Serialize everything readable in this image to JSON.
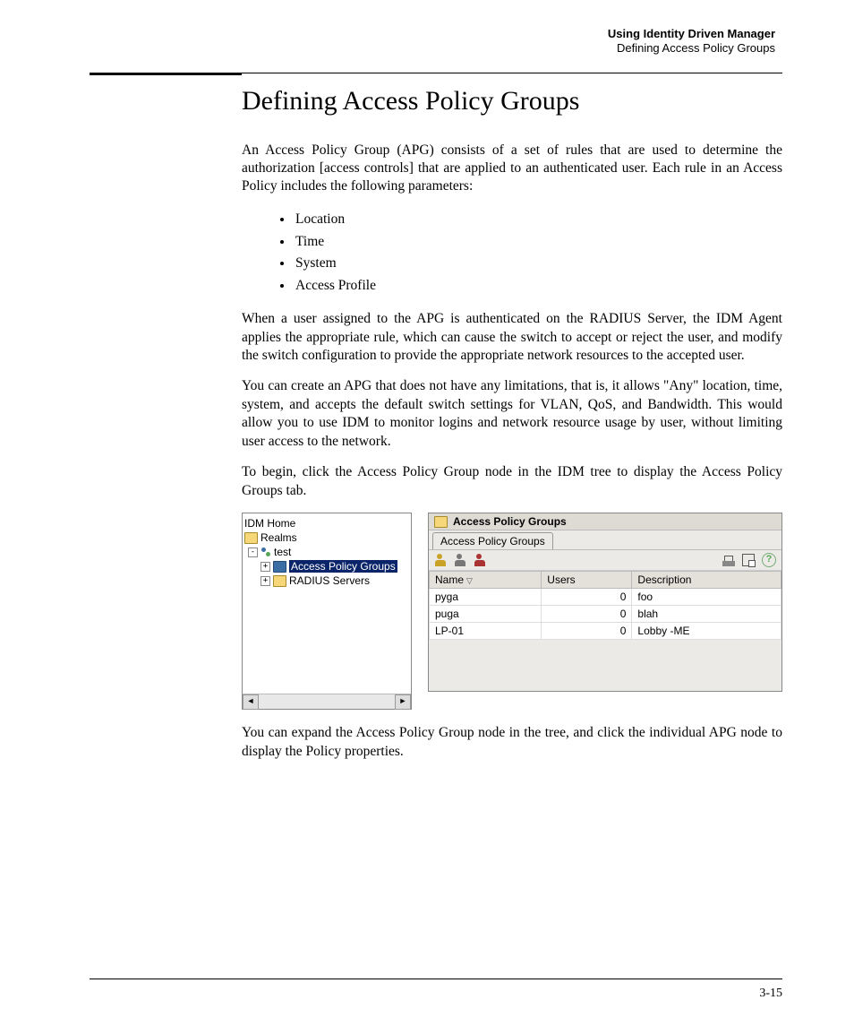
{
  "runningHead": {
    "bold": "Using Identity Driven Manager",
    "light": "Defining Access Policy Groups"
  },
  "title": "Defining Access Policy Groups",
  "para1": "An Access Policy Group (APG) consists of a set of rules that are used to determine the authorization [access controls] that are applied to an authenticated user. Each rule in an Access Policy includes the following parameters:",
  "bullets": [
    "Location",
    "Time",
    "System",
    "Access Profile"
  ],
  "para2": "When a user assigned to the APG is authenticated on the RADIUS Server, the IDM Agent applies the appropriate rule, which can cause the switch to accept or reject the user, and modify the switch configuration to provide the appropriate network resources to the accepted user.",
  "para3": "You can create an APG that does not have any limitations, that is, it allows \"Any\" location, time, system, and accepts the default switch settings for VLAN, QoS, and Bandwidth. This would allow you to use IDM to monitor logins and network resource usage by user, without limiting user access to the network.",
  "para4": "To begin, click the Access Policy Group node in the IDM tree to display the Access Policy Groups tab.",
  "tree": {
    "root": "IDM Home",
    "realms": "Realms",
    "test": "test",
    "apg": "Access Policy Groups",
    "radius": "RADIUS Servers"
  },
  "apgPanel": {
    "title": "Access Policy Groups",
    "tab": "Access Policy Groups",
    "columns": {
      "name": "Name",
      "users": "Users",
      "desc": "Description"
    },
    "rows": [
      {
        "name": "pyga",
        "users": "0",
        "desc": "foo"
      },
      {
        "name": "puga",
        "users": "0",
        "desc": "blah"
      },
      {
        "name": "LP-01",
        "users": "0",
        "desc": "Lobby -ME"
      }
    ],
    "helpGlyph": "?"
  },
  "para5": "You can expand the Access Policy Group node in the tree, and click the individual APG node to display the Policy properties.",
  "pageNumber": "3-15",
  "chart_data": {
    "type": "table",
    "title": "Access Policy Groups",
    "columns": [
      "Name",
      "Users",
      "Description"
    ],
    "rows": [
      [
        "pyga",
        0,
        "foo"
      ],
      [
        "puga",
        0,
        "blah"
      ],
      [
        "LP-01",
        0,
        "Lobby -ME"
      ]
    ]
  }
}
